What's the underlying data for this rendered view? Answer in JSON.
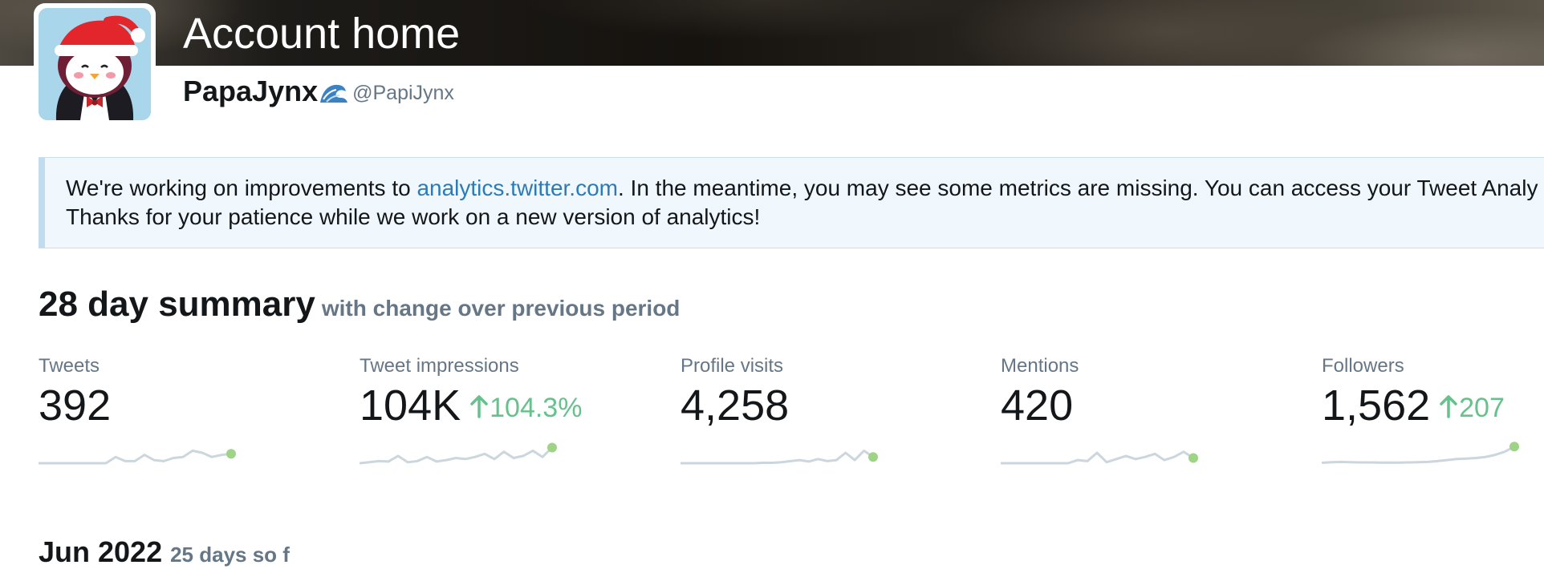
{
  "header": {
    "title": "Account home"
  },
  "profile": {
    "display_name": "PapaJynx",
    "emoji_icon": "wave-icon",
    "handle": "@PapiJynx"
  },
  "notice": {
    "text_before": "We're working on improvements to ",
    "link_text": "analytics.twitter.com",
    "text_after": ". In the meantime, you may see some metrics are missing. You can access your Tweet Analy",
    "line2": "Thanks for your patience while we work on a new version of analytics!"
  },
  "summary": {
    "title": "28 day summary",
    "subtitle": "with change over previous period",
    "metrics": [
      {
        "label": "Tweets",
        "value": "392",
        "change": "",
        "sparkline": [
          0,
          0,
          0,
          0,
          0,
          0,
          0,
          0,
          0.3,
          0.1,
          0.1,
          0.4,
          0.15,
          0.1,
          0.25,
          0.3,
          0.6,
          0.5,
          0.3,
          0.4,
          0.45
        ]
      },
      {
        "label": "Tweet impressions",
        "value": "104K",
        "change": "104.3%",
        "sparkline": [
          0,
          0.05,
          0.1,
          0.08,
          0.35,
          0.05,
          0.1,
          0.3,
          0.08,
          0.15,
          0.25,
          0.2,
          0.3,
          0.45,
          0.2,
          0.55,
          0.25,
          0.35,
          0.6,
          0.3,
          0.75
        ]
      },
      {
        "label": "Profile visits",
        "value": "4,258",
        "change": "",
        "sparkline": [
          0,
          0,
          0,
          0,
          0,
          0,
          0,
          0,
          0,
          0.02,
          0.02,
          0.05,
          0.1,
          0.15,
          0.08,
          0.2,
          0.1,
          0.15,
          0.5,
          0.15,
          0.6,
          0.3
        ]
      },
      {
        "label": "Mentions",
        "value": "420",
        "change": "",
        "sparkline": [
          0,
          0,
          0,
          0,
          0,
          0,
          0,
          0,
          0.15,
          0.1,
          0.5,
          0.05,
          0.2,
          0.35,
          0.2,
          0.3,
          0.45,
          0.15,
          0.3,
          0.55,
          0.25
        ]
      },
      {
        "label": "Followers",
        "value": "1,562",
        "change": "207",
        "sparkline": [
          0.02,
          0.05,
          0.06,
          0.05,
          0.04,
          0.04,
          0.03,
          0.03,
          0.03,
          0.04,
          0.05,
          0.06,
          0.1,
          0.15,
          0.2,
          0.22,
          0.25,
          0.3,
          0.4,
          0.55,
          0.8
        ]
      }
    ]
  },
  "month": {
    "title": "Jun 2022",
    "subtitle": "25 days so f"
  },
  "colors": {
    "accent_green": "#66c18c",
    "link_blue": "#2b7bb9",
    "sparkline_line": "#ccd6dd",
    "sparkline_dot": "#9fd487",
    "muted_text": "#657786"
  }
}
